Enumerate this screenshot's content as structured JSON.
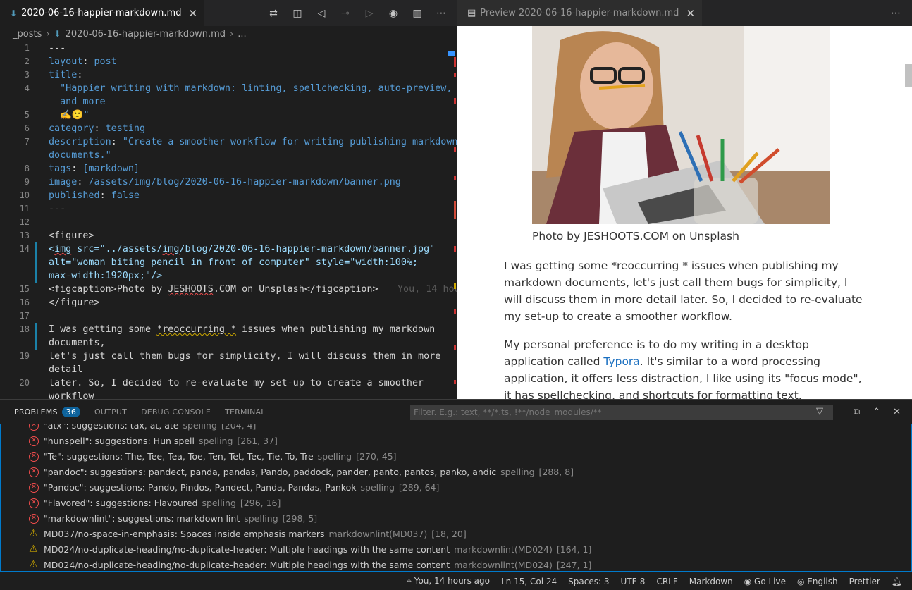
{
  "editor": {
    "tab_title": "2020-06-16-happier-markdown.md",
    "breadcrumb": [
      "_posts",
      "2020-06-16-happier-markdown.md",
      "..."
    ]
  },
  "code_lines": [
    {
      "n": "1",
      "t": "---"
    },
    {
      "n": "2",
      "a": "layout",
      "b": "post"
    },
    {
      "n": "3",
      "a": "title",
      "b": ""
    },
    {
      "n": "4",
      "t": "  \"Happier writing with markdown: linting, spellchecking, auto-preview,"
    },
    {
      "n": "",
      "t": "  and more"
    },
    {
      "n": "5",
      "t": "  ✍️🙂\""
    },
    {
      "n": "6",
      "a": "category",
      "b": "testing"
    },
    {
      "n": "7",
      "a": "description",
      "b": "\"Create a smoother workflow for writing publishing markdown"
    },
    {
      "n": "",
      "t": "documents.\""
    },
    {
      "n": "8",
      "a": "tags",
      "b": "[markdown]"
    },
    {
      "n": "9",
      "a": "image",
      "b": "/assets/img/blog/2020-06-16-happier-markdown/banner.png"
    },
    {
      "n": "10",
      "a": "published",
      "b": "false"
    },
    {
      "n": "11",
      "t": "---"
    },
    {
      "n": "12",
      "t": ""
    },
    {
      "n": "13",
      "t": "<figure>"
    },
    {
      "n": "14",
      "t": "<img src=\"../assets/img/blog/2020-06-16-happier-markdown/banner.jpg\""
    },
    {
      "n": "",
      "t": "alt=\"woman biting pencil in front of computer\" style=\"width:100%;"
    },
    {
      "n": "",
      "t": "max-width:1920px;\"/>"
    },
    {
      "n": "15",
      "t": "<figcaption>Photo by JESHOOTS.COM on Unsplash</figcaption>"
    },
    {
      "n": "16",
      "t": "</figure>"
    },
    {
      "n": "17",
      "t": ""
    },
    {
      "n": "18",
      "t": "I was getting some *reoccurring * issues when publishing my markdown"
    },
    {
      "n": "",
      "t": "documents,"
    },
    {
      "n": "19",
      "t": "let's just call them bugs for simplicity, I will discuss them in more"
    },
    {
      "n": "",
      "t": "detail"
    },
    {
      "n": "20",
      "t": "later. So, I decided to re-evaluate my set-up to create a smoother"
    },
    {
      "n": "",
      "t": "workflow"
    }
  ],
  "blame": "You, 14 hours ago",
  "preview": {
    "tab_title": "Preview 2020-06-16-happier-markdown.md",
    "caption": "Photo by JESHOOTS.COM on Unsplash",
    "para1": "I was getting some *reoccurring * issues when publishing my markdown documents, let's just call them bugs for simplicity, I will discuss them in more detail later. So, I decided to re-evaluate my set-up to create a smoother workflow.",
    "para2_before": "My personal preference is to do my writing in a desktop application called ",
    "para2_link": "Typora",
    "para2_after": ". It's similar to a word processing application, it offers less distraction, I like using its \"focus mode\", it has spellchecking, and shortcuts for formatting text."
  },
  "panel": {
    "tabs": [
      "PROBLEMS",
      "OUTPUT",
      "DEBUG CONSOLE",
      "TERMINAL"
    ],
    "problem_count": "36",
    "filter_placeholder": "Filter. E.g.: text, **/*.ts, !**/node_modules/**"
  },
  "problems": [
    {
      "type": "error",
      "msg": "\"atx\": suggestions: tax, at, ate",
      "src": "spelling",
      "pos": "[204, 4]"
    },
    {
      "type": "error",
      "msg": "\"hunspell\": suggestions: Hun spell",
      "src": "spelling",
      "pos": "[261, 37]"
    },
    {
      "type": "error",
      "msg": "\"Te\": suggestions: The, Tee, Tea, Toe, Ten, Tet, Tec, Tie, To, Tre",
      "src": "spelling",
      "pos": "[270, 45]"
    },
    {
      "type": "error",
      "msg": "\"pandoc\": suggestions: pandect, panda, pandas, Pando, paddock, pander, panto, pantos, panko, andic",
      "src": "spelling",
      "pos": "[288, 8]"
    },
    {
      "type": "error",
      "msg": "\"Pandoc\": suggestions: Pando, Pindos, Pandect, Panda, Pandas, Pankok",
      "src": "spelling",
      "pos": "[289, 64]"
    },
    {
      "type": "error",
      "msg": "\"Flavored\": suggestions: Flavoured",
      "src": "spelling",
      "pos": "[296, 16]"
    },
    {
      "type": "error",
      "msg": "\"markdownlint\": suggestions: markdown lint",
      "src": "spelling",
      "pos": "[298, 5]"
    },
    {
      "type": "warn",
      "msg": "MD037/no-space-in-emphasis: Spaces inside emphasis markers",
      "src": "markdownlint(MD037)",
      "pos": "[18, 20]"
    },
    {
      "type": "warn",
      "msg": "MD024/no-duplicate-heading/no-duplicate-header: Multiple headings with the same content",
      "src": "markdownlint(MD024)",
      "pos": "[164, 1]"
    },
    {
      "type": "warn",
      "msg": "MD024/no-duplicate-heading/no-duplicate-header: Multiple headings with the same content",
      "src": "markdownlint(MD024)",
      "pos": "[247, 1]"
    }
  ],
  "status": {
    "blame": "You, 14 hours ago",
    "position": "Ln 15, Col 24",
    "spaces": "Spaces: 3",
    "encoding": "UTF-8",
    "eol": "CRLF",
    "language": "Markdown",
    "golive": "Go Live",
    "spell_lang": "English",
    "formatter": "Prettier"
  }
}
